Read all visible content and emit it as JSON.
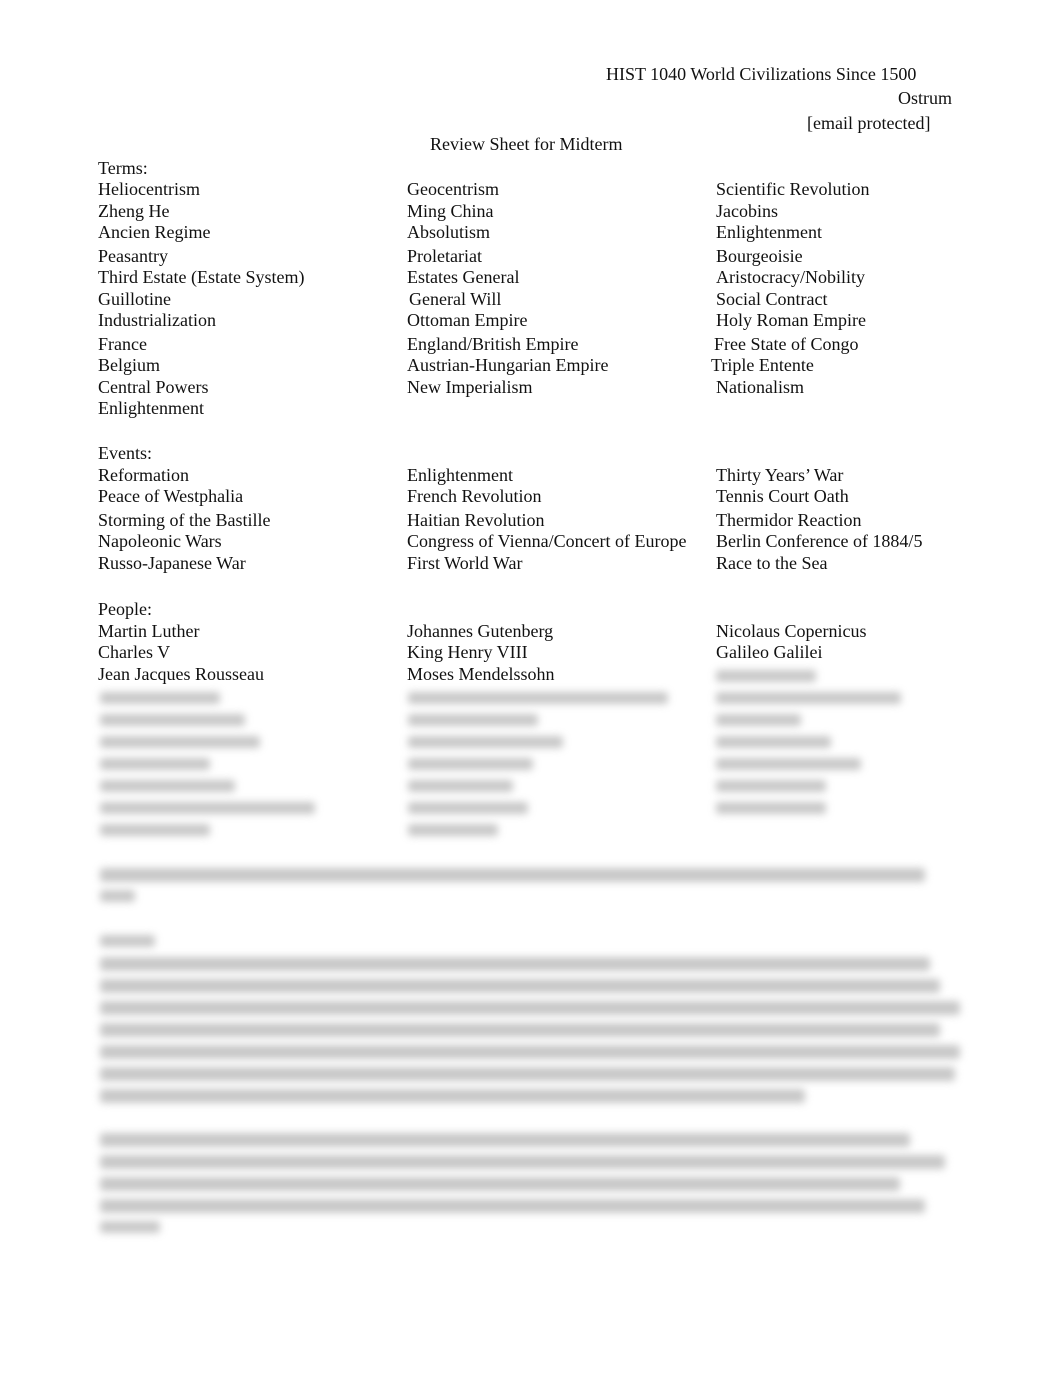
{
  "header": {
    "course": "HIST 1040 World Civilizations Since 1500",
    "instructor": "Ostrum",
    "email": "[email protected]"
  },
  "title": "Review Sheet for Midterm",
  "sections": {
    "terms": {
      "label": "Terms:",
      "col1": [
        "Heliocentrism",
        "Zheng He",
        "Ancien Regime",
        "Peasantry",
        "Third Estate (Estate System)",
        "Guillotine",
        "Industrialization",
        "France",
        "Belgium",
        "Central Powers",
        "Enlightenment"
      ],
      "col2": [
        "Geocentrism",
        "Ming China",
        "Absolutism",
        "Proletariat",
        "Estates General",
        "General Will",
        "Ottoman Empire",
        "England/British Empire",
        "Austrian-Hungarian Empire",
        "New Imperialism"
      ],
      "col3": [
        "Scientific Revolution",
        "Jacobins",
        "Enlightenment",
        "Bourgeoisie",
        "Aristocracy/Nobility",
        "Social Contract",
        "Holy Roman Empire",
        "Free State of Congo",
        "Triple Entente",
        "Nationalism"
      ]
    },
    "events": {
      "label": "Events:",
      "col1": [
        "Reformation",
        "Peace of Westphalia",
        "Storming of the Bastille",
        "Napoleonic Wars",
        "Russo-Japanese War"
      ],
      "col2": [
        "Enlightenment",
        "French Revolution",
        "Haitian Revolution",
        "Congress of Vienna/Concert of Europe",
        "First World War"
      ],
      "col3": [
        "Thirty Years’ War",
        "Tennis Court Oath",
        "Thermidor Reaction",
        "Berlin Conference of 1884/5",
        "Race to the Sea"
      ]
    },
    "people": {
      "label": "People:",
      "col1": [
        "Martin Luther",
        "Charles V",
        "Jean Jacques Rousseau"
      ],
      "col2": [
        "Johannes Gutenberg",
        "King Henry VIII",
        "Moses Mendelssohn"
      ],
      "col3": [
        "Nicolaus Copernicus",
        "Galileo Galilei"
      ]
    }
  }
}
